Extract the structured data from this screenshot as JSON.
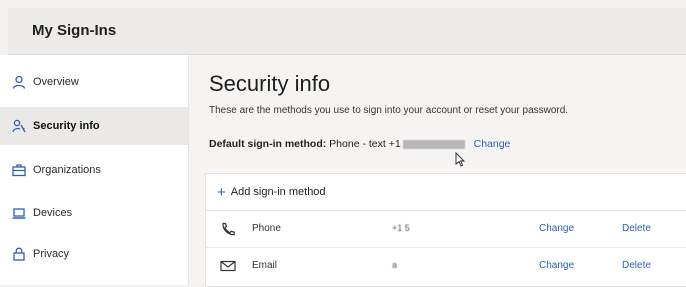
{
  "header": {
    "title": "My Sign-Ins"
  },
  "sidebar": {
    "items": [
      {
        "label": "Overview",
        "icon": "person-icon",
        "active": false
      },
      {
        "label": "Security info",
        "icon": "key-person-icon",
        "active": true
      },
      {
        "label": "Organizations",
        "icon": "briefcase-icon",
        "active": false
      },
      {
        "label": "Devices",
        "icon": "laptop-icon",
        "active": false
      },
      {
        "label": "Privacy",
        "icon": "lock-icon",
        "active": false
      }
    ]
  },
  "main": {
    "title": "Security info",
    "description": "These are the methods you use to sign into your account or reset your password.",
    "default_label": "Default sign-in method:",
    "default_value": "Phone - text +1",
    "default_change": "Change",
    "add_method": "Add sign-in method",
    "methods": [
      {
        "name": "Phone",
        "value": "+1 5",
        "change": "Change",
        "delete": "Delete",
        "icon": "phone-icon"
      },
      {
        "name": "Email",
        "value": "a",
        "change": "Change",
        "delete": "Delete",
        "icon": "email-icon"
      }
    ]
  },
  "colors": {
    "accent": "#2f5fb5",
    "sidebar_active": "#eae9e8",
    "header_bg": "#ecebea"
  }
}
